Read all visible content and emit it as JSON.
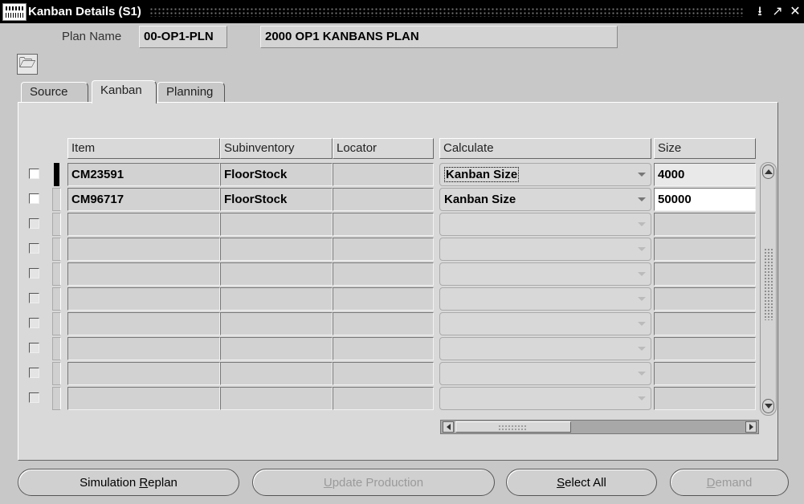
{
  "window": {
    "title": "Kanban Details (S1)",
    "controls": [
      "minimize-icon",
      "maximize-icon",
      "close-icon"
    ]
  },
  "header": {
    "plan_name_label": "Plan Name",
    "plan_code": "00-OP1-PLN",
    "plan_description": "2000 OP1 KANBANS PLAN"
  },
  "toolbar": {
    "open_folder_icon": "open-folder-icon"
  },
  "tabs": [
    {
      "label": "Source",
      "active": false
    },
    {
      "label": "Kanban",
      "active": true
    },
    {
      "label": "Planning",
      "active": false
    }
  ],
  "table": {
    "columns": {
      "item": "Item",
      "subinventory": "Subinventory",
      "locator": "Locator",
      "calculate": "Calculate",
      "size": "Size"
    },
    "rows": [
      {
        "item": "CM23591",
        "subinventory": "FloorStock",
        "locator": "",
        "calculate": "Kanban Size",
        "size": "4000"
      },
      {
        "item": "CM96717",
        "subinventory": "FloorStock",
        "locator": "",
        "calculate": "Kanban Size",
        "size": "50000"
      }
    ],
    "empty_rows": 8
  },
  "buttons": {
    "simulation_replan": {
      "prefix": "Simulation ",
      "accel": "R",
      "suffix": "eplan",
      "enabled": true
    },
    "update_production": {
      "prefix": "",
      "accel": "U",
      "suffix": "pdate Production",
      "enabled": false
    },
    "select_all": {
      "prefix": "",
      "accel": "S",
      "suffix": "elect All",
      "enabled": true
    },
    "demand": {
      "prefix": "",
      "accel": "D",
      "suffix": "emand",
      "enabled": false
    }
  },
  "colors": {
    "titlebar": "#000000",
    "background": "#c8c8c8",
    "panel": "#d9d9d9"
  }
}
